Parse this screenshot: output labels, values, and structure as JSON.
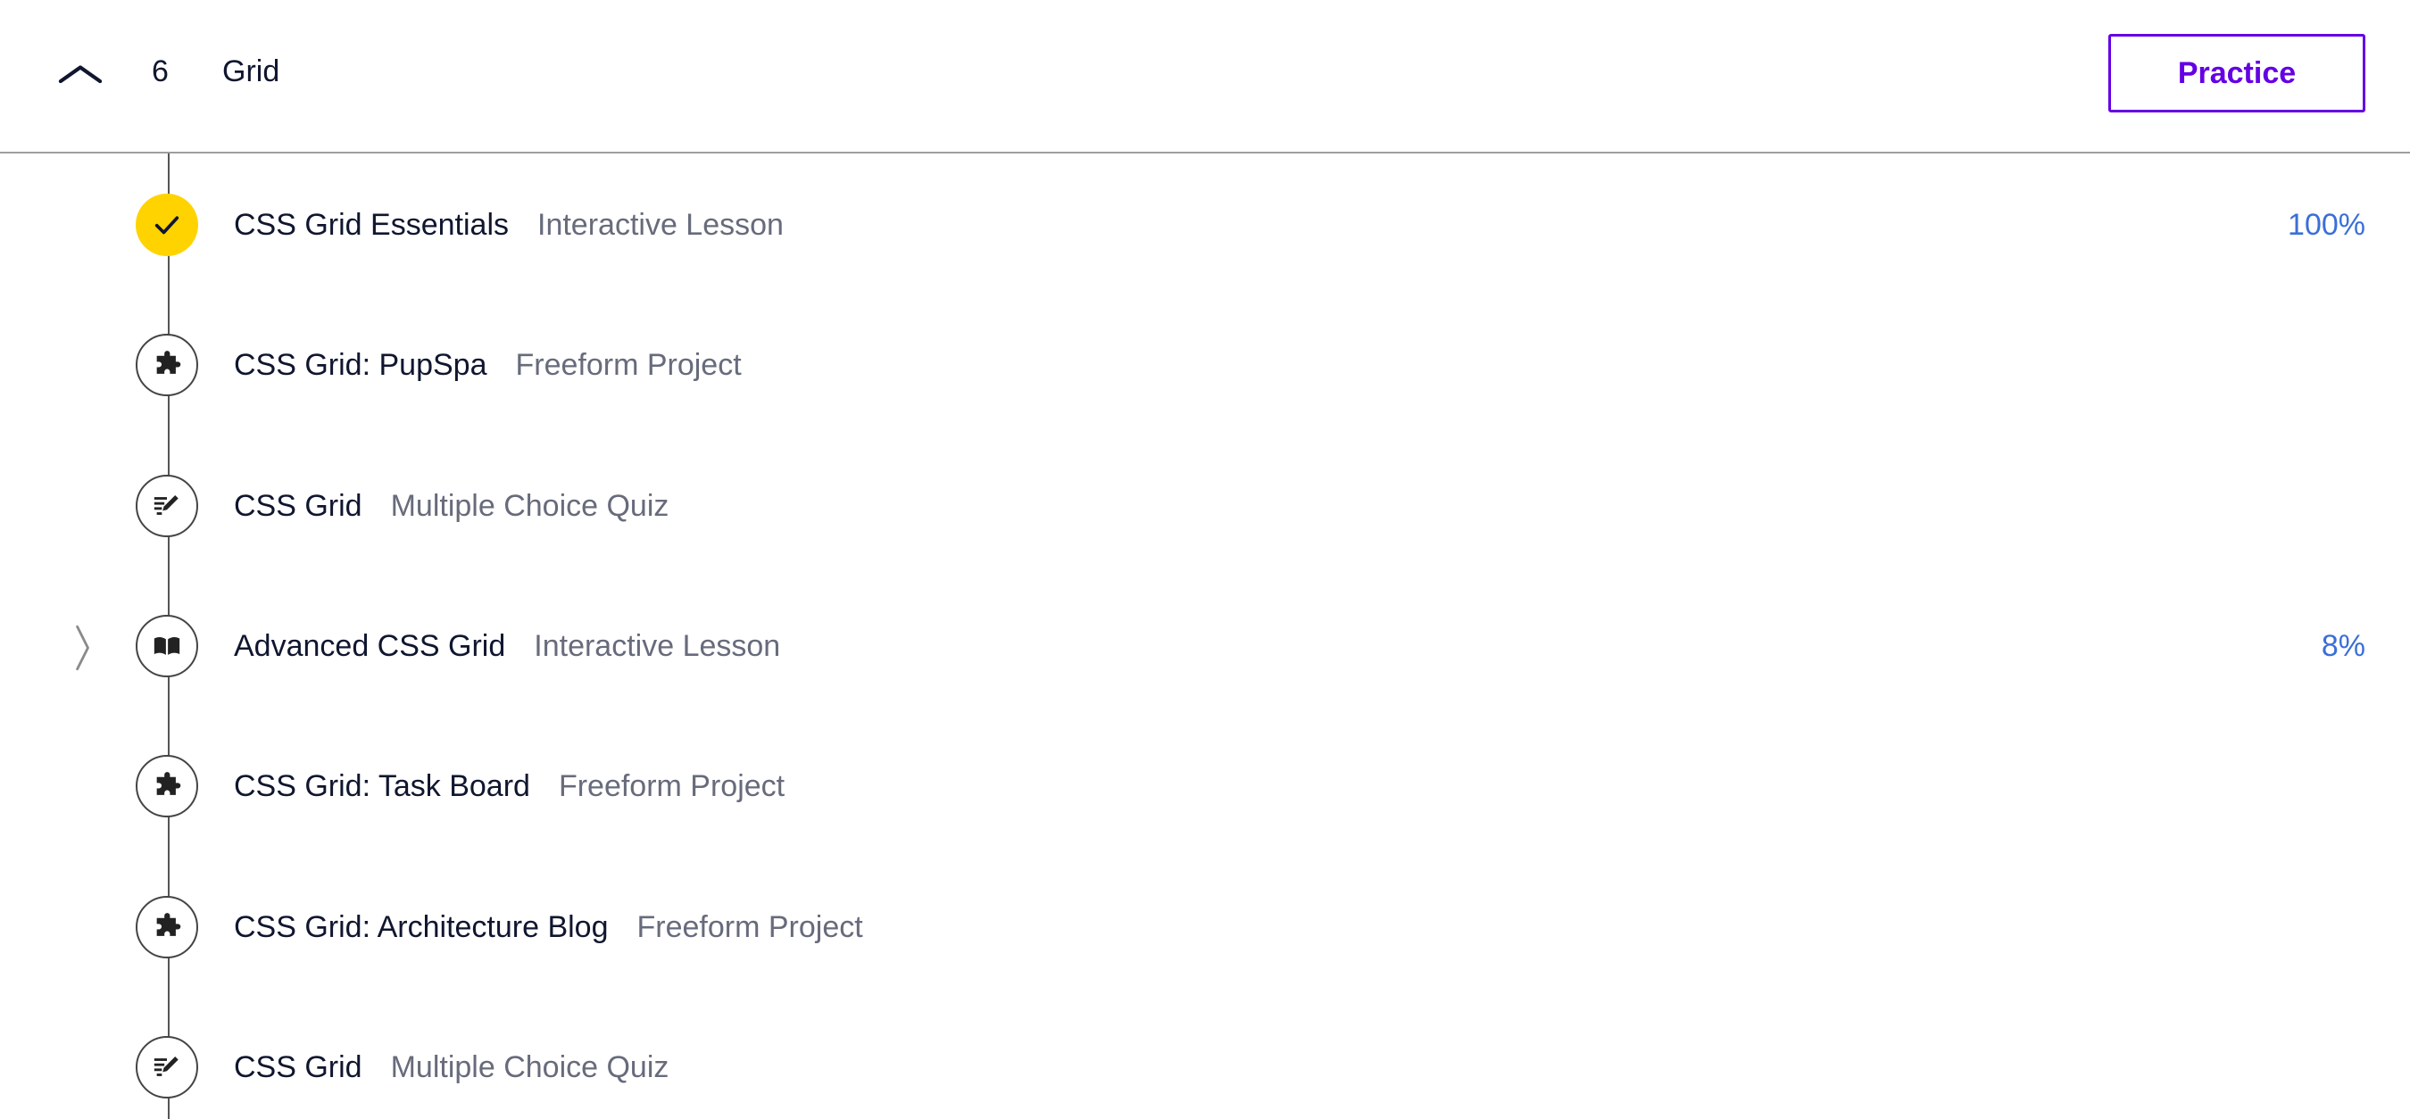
{
  "header": {
    "collapse_icon": "chevron-up-icon",
    "module_number": "6",
    "module_title": "Grid",
    "practice_label": "Practice"
  },
  "colors": {
    "accent": "#6400e4",
    "complete": "#ffd300",
    "progress": "#3a6fd8",
    "muted": "#676b7b"
  },
  "items": [
    {
      "title": "CSS Grid Essentials",
      "type": "Interactive Lesson",
      "progress": "100%",
      "icon": "check-icon",
      "status": "complete"
    },
    {
      "title": "CSS Grid: PupSpa",
      "type": "Freeform Project",
      "progress": "",
      "icon": "puzzle-icon",
      "status": "not-started"
    },
    {
      "title": "CSS Grid",
      "type": "Multiple Choice Quiz",
      "progress": "",
      "icon": "quiz-pencil-icon",
      "status": "not-started"
    },
    {
      "title": "Advanced CSS Grid",
      "type": "Interactive Lesson",
      "progress": "8%",
      "icon": "book-icon",
      "status": "in-progress",
      "expand_icon": "chevron-right-icon"
    },
    {
      "title": "CSS Grid: Task Board",
      "type": "Freeform Project",
      "progress": "",
      "icon": "puzzle-icon",
      "status": "not-started"
    },
    {
      "title": "CSS Grid: Architecture Blog",
      "type": "Freeform Project",
      "progress": "",
      "icon": "puzzle-icon",
      "status": "not-started"
    },
    {
      "title": "CSS Grid",
      "type": "Multiple Choice Quiz",
      "progress": "",
      "icon": "quiz-pencil-icon",
      "status": "not-started"
    }
  ]
}
